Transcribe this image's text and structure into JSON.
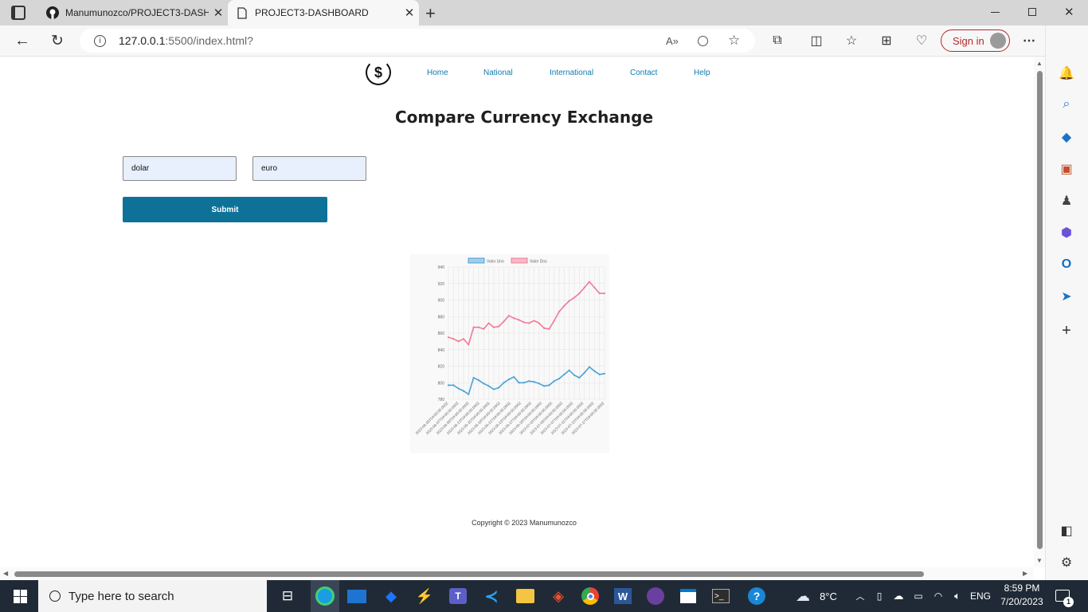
{
  "browser": {
    "tabs": [
      {
        "title": "Manumunozco/PROJECT3-DASH",
        "icon": "github-icon"
      },
      {
        "title": "PROJECT3-DASHBOARD",
        "icon": "page-icon"
      }
    ],
    "url_host": "127.0.0.1",
    "url_rest": ":5500/index.html?",
    "signin_label": "Sign in"
  },
  "nav": {
    "items": [
      "Home",
      "National",
      "International",
      "Contact",
      "Help"
    ]
  },
  "main": {
    "title": "Compare Currency Exchange",
    "input1_value": "dolar",
    "input2_value": "euro",
    "submit_label": "Submit"
  },
  "chart_data": {
    "type": "line",
    "title": "",
    "xlabel": "",
    "ylabel": "",
    "ylim": [
      780,
      940
    ],
    "yticks": [
      780,
      800,
      820,
      840,
      860,
      880,
      900,
      920,
      940
    ],
    "grid": true,
    "legend": "top",
    "categories": [
      "2023-06-05T04:00:00.000Z",
      "2023-06-06T04:00:00.000Z",
      "2023-06-07T04:00:00.000Z",
      "2023-06-08T04:00:00.000Z",
      "2023-06-09T04:00:00.000Z",
      "2023-06-12T04:00:00.000Z",
      "2023-06-13T04:00:00.000Z",
      "2023-06-14T04:00:00.000Z",
      "2023-06-15T04:00:00.000Z",
      "2023-06-16T04:00:00.000Z",
      "2023-06-19T04:00:00.000Z",
      "2023-06-20T04:00:00.000Z",
      "2023-06-21T04:00:00.000Z",
      "2023-06-22T04:00:00.000Z",
      "2023-06-23T04:00:00.000Z",
      "2023-06-26T04:00:00.000Z",
      "2023-06-27T04:00:00.000Z",
      "2023-06-28T04:00:00.000Z",
      "2023-06-29T04:00:00.000Z",
      "2023-06-30T04:00:00.000Z",
      "2023-07-03T04:00:00.000Z",
      "2023-07-04T04:00:00.000Z",
      "2023-07-05T04:00:00.000Z",
      "2023-07-06T04:00:00.000Z",
      "2023-07-07T04:00:00.000Z",
      "2023-07-10T04:00:00.000Z",
      "2023-07-11T04:00:00.000Z",
      "2023-07-12T04:00:00.000Z",
      "2023-07-13T04:00:00.000Z",
      "2023-07-14T04:00:00.000Z",
      "2023-07-17T04:00:00.000Z",
      "2023-07-18T04:00:00.000Z"
    ],
    "tick_labels": [
      "2023-06-05T04:00:00.000Z",
      "2023-06-07T04:00:00.000Z",
      "2023-06-09T04:00:00.000Z",
      "2023-06-13T04:00:00.000Z",
      "2023-06-15T04:00:00.000Z",
      "2023-06-19T04:00:00.000Z",
      "2023-06-21T04:00:00.000Z",
      "2023-06-23T04:00:00.000Z",
      "2023-06-27T04:00:00.000Z",
      "2023-06-29T04:00:00.000Z",
      "2023-07-03T04:00:00.000Z",
      "2023-07-05T04:00:00.000Z",
      "2023-07-07T04:00:00.000Z",
      "2023-07-11T04:00:00.000Z",
      "2023-07-13T04:00:00.000Z",
      "2023-07-17T04:00:00.000Z"
    ],
    "series": [
      {
        "name": "Valor Uno",
        "color": "#4aa3d8",
        "values": [
          797,
          797,
          793,
          790,
          786,
          806,
          803,
          799,
          796,
          792,
          794,
          800,
          804,
          807,
          800,
          800,
          802,
          801,
          799,
          796,
          797,
          802,
          805,
          810,
          815,
          809,
          806,
          812,
          819,
          814,
          810,
          811
        ]
      },
      {
        "name": "Valor Dos",
        "color": "#f27a96",
        "values": [
          855,
          853,
          850,
          853,
          846,
          867,
          867,
          865,
          872,
          867,
          868,
          874,
          881,
          878,
          876,
          873,
          872,
          875,
          872,
          866,
          865,
          875,
          886,
          893,
          899,
          903,
          908,
          915,
          922,
          915,
          908,
          908
        ]
      }
    ]
  },
  "footer": {
    "text": "Copyright © 2023 Manumunozco"
  },
  "taskbar": {
    "search_placeholder": "Type here to search",
    "weather": "8°C",
    "lang": "ENG",
    "time": "8:59 PM",
    "date": "7/20/2023",
    "notif_count": "1"
  }
}
